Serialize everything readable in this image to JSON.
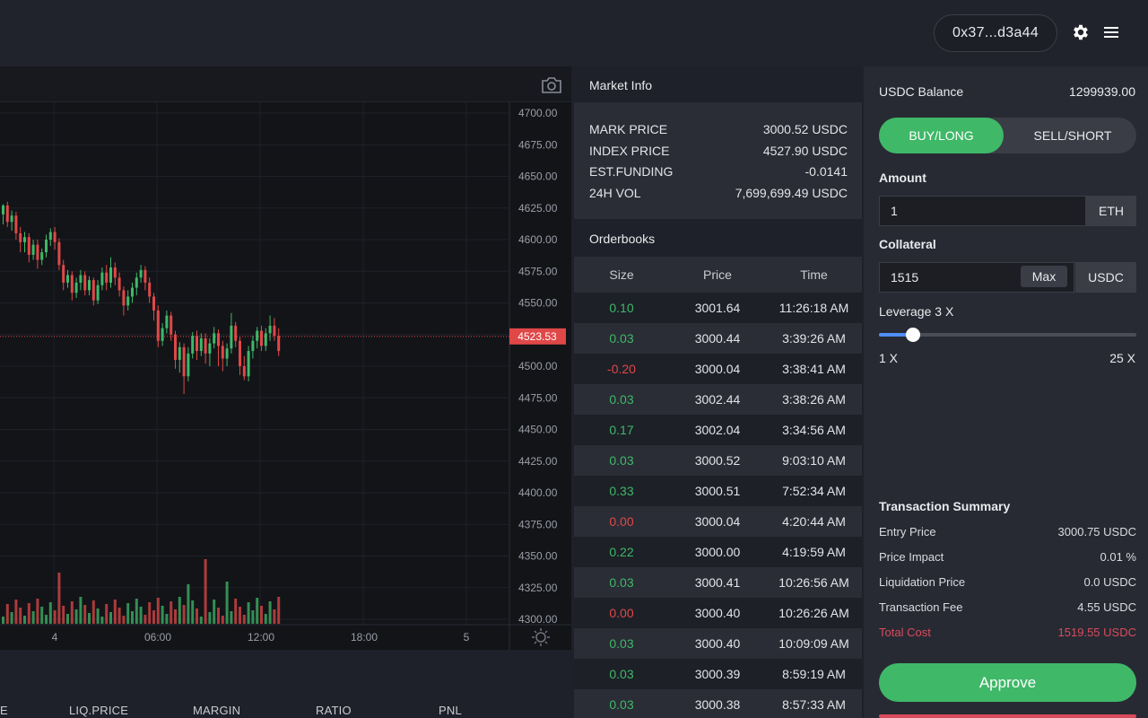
{
  "header": {
    "wallet_address": "0x37...d3a44",
    "icons": {
      "settings": "gear-icon",
      "menu": "hamburger-menu-icon"
    }
  },
  "chart": {
    "camera_icon": "camera-icon",
    "settings_icon": "sun-settings-icon",
    "current_price_label": "4523.53",
    "colors": {
      "up": "#3fb868",
      "down": "#e04848",
      "price_tag": "#e04848"
    }
  },
  "chart_data": {
    "type": "candlestick",
    "price_axis_ticks": [
      "4700.00",
      "4675.00",
      "4650.00",
      "4625.00",
      "4600.00",
      "4575.00",
      "4550.00",
      "4525.00",
      "4500.00",
      "4475.00",
      "4450.00",
      "4425.00",
      "4400.00",
      "4375.00",
      "4350.00",
      "4325.00",
      "4300.00"
    ],
    "ylim": [
      4300,
      4700
    ],
    "time_axis_ticks": [
      "4",
      "06:00",
      "12:00",
      "18:00",
      "5"
    ],
    "current_price": 4523.53,
    "candles": [
      [
        4620,
        4627,
        4612,
        4628
      ],
      [
        4627,
        4614,
        4610,
        4630
      ],
      [
        4614,
        4619,
        4607,
        4623
      ],
      [
        4619,
        4605,
        4600,
        4622
      ],
      [
        4605,
        4598,
        4590,
        4610
      ],
      [
        4598,
        4602,
        4590,
        4606
      ],
      [
        4602,
        4588,
        4582,
        4605
      ],
      [
        4588,
        4596,
        4584,
        4600
      ],
      [
        4596,
        4584,
        4577,
        4600
      ],
      [
        4584,
        4590,
        4580,
        4593
      ],
      [
        4590,
        4600,
        4586,
        4604
      ],
      [
        4600,
        4606,
        4595,
        4609
      ],
      [
        4606,
        4598,
        4592,
        4610
      ],
      [
        4598,
        4580,
        4576,
        4601
      ],
      [
        4580,
        4566,
        4560,
        4584
      ],
      [
        4566,
        4572,
        4562,
        4576
      ],
      [
        4572,
        4558,
        4552,
        4575
      ],
      [
        4558,
        4566,
        4554,
        4570
      ],
      [
        4566,
        4572,
        4560,
        4576
      ],
      [
        4572,
        4560,
        4556,
        4575
      ],
      [
        4560,
        4568,
        4556,
        4571
      ],
      [
        4568,
        4552,
        4548,
        4570
      ],
      [
        4552,
        4564,
        4549,
        4568
      ],
      [
        4564,
        4574,
        4560,
        4578
      ],
      [
        4574,
        4566,
        4560,
        4580
      ],
      [
        4566,
        4578,
        4562,
        4586
      ],
      [
        4578,
        4570,
        4564,
        4582
      ],
      [
        4570,
        4560,
        4555,
        4574
      ],
      [
        4560,
        4548,
        4540,
        4563
      ],
      [
        4548,
        4555,
        4544,
        4560
      ],
      [
        4555,
        4562,
        4550,
        4566
      ],
      [
        4562,
        4570,
        4556,
        4574
      ],
      [
        4570,
        4576,
        4566,
        4580
      ],
      [
        4576,
        4566,
        4560,
        4579
      ],
      [
        4566,
        4555,
        4550,
        4570
      ],
      [
        4555,
        4544,
        4536,
        4558
      ],
      [
        4544,
        4520,
        4515,
        4548
      ],
      [
        4520,
        4530,
        4516,
        4534
      ],
      [
        4530,
        4540,
        4526,
        4544
      ],
      [
        4540,
        4525,
        4520,
        4543
      ],
      [
        4525,
        4505,
        4498,
        4528
      ],
      [
        4505,
        4515,
        4495,
        4519
      ],
      [
        4515,
        4492,
        4478,
        4518
      ],
      [
        4492,
        4510,
        4488,
        4515
      ],
      [
        4510,
        4524,
        4506,
        4527
      ],
      [
        4524,
        4512,
        4505,
        4528
      ],
      [
        4512,
        4522,
        4508,
        4526
      ],
      [
        4522,
        4510,
        4502,
        4526
      ],
      [
        4510,
        4518,
        4500,
        4522
      ],
      [
        4518,
        4526,
        4514,
        4531
      ],
      [
        4526,
        4516,
        4500,
        4529
      ],
      [
        4516,
        4506,
        4496,
        4520
      ],
      [
        4506,
        4514,
        4500,
        4518
      ],
      [
        4514,
        4532,
        4510,
        4542
      ],
      [
        4532,
        4520,
        4515,
        4535
      ],
      [
        4520,
        4500,
        4493,
        4523
      ],
      [
        4500,
        4492,
        4489,
        4508
      ],
      [
        4492,
        4512,
        4488,
        4516
      ],
      [
        4512,
        4520,
        4506,
        4524
      ],
      [
        4520,
        4528,
        4514,
        4531
      ],
      [
        4528,
        4516,
        4512,
        4532
      ],
      [
        4516,
        4526,
        4512,
        4530
      ],
      [
        4526,
        4532,
        4520,
        4540
      ],
      [
        4532,
        4524,
        4520,
        4538
      ],
      [
        4524,
        4512,
        4508,
        4530
      ]
    ],
    "candle_fields": [
      "open",
      "close",
      "low",
      "high"
    ]
  },
  "market_info": {
    "title": "Market Info",
    "rows": [
      {
        "label": "MARK PRICE",
        "value": "3000.52 USDC"
      },
      {
        "label": "INDEX PRICE",
        "value": "4527.90 USDC"
      },
      {
        "label": "EST.FUNDING",
        "value": "-0.0141"
      },
      {
        "label": "24H VOL",
        "value": "7,699,699.49 USDC"
      }
    ]
  },
  "orderbook": {
    "title": "Orderbooks",
    "headers": {
      "size": "Size",
      "price": "Price",
      "time": "Time"
    },
    "rows": [
      {
        "size": "0.10",
        "price": "3001.64",
        "time": "11:26:18 AM",
        "dir": "up"
      },
      {
        "size": "0.03",
        "price": "3000.44",
        "time": "3:39:26 AM",
        "dir": "up"
      },
      {
        "size": "-0.20",
        "price": "3000.04",
        "time": "3:38:41 AM",
        "dir": "down"
      },
      {
        "size": "0.03",
        "price": "3002.44",
        "time": "3:38:26 AM",
        "dir": "up"
      },
      {
        "size": "0.17",
        "price": "3002.04",
        "time": "3:34:56 AM",
        "dir": "up"
      },
      {
        "size": "0.03",
        "price": "3000.52",
        "time": "9:03:10 AM",
        "dir": "up"
      },
      {
        "size": "0.33",
        "price": "3000.51",
        "time": "7:52:34 AM",
        "dir": "up"
      },
      {
        "size": "0.00",
        "price": "3000.04",
        "time": "4:20:44 AM",
        "dir": "down"
      },
      {
        "size": "0.22",
        "price": "3000.00",
        "time": "4:19:59 AM",
        "dir": "up"
      },
      {
        "size": "0.03",
        "price": "3000.41",
        "time": "10:26:56 AM",
        "dir": "up"
      },
      {
        "size": "0.00",
        "price": "3000.40",
        "time": "10:26:26 AM",
        "dir": "down"
      },
      {
        "size": "0.03",
        "price": "3000.40",
        "time": "10:09:09 AM",
        "dir": "up"
      },
      {
        "size": "0.03",
        "price": "3000.39",
        "time": "8:59:19 AM",
        "dir": "up"
      },
      {
        "size": "0.03",
        "price": "3000.38",
        "time": "8:57:33 AM",
        "dir": "up"
      }
    ]
  },
  "positions": {
    "headers": [
      "E",
      "LIQ.PRICE",
      "MARGIN",
      "RATIO",
      "PNL"
    ]
  },
  "trade": {
    "balance_label": "USDC Balance",
    "balance_value": "1299939.00",
    "buy_label": "BUY/LONG",
    "sell_label": "SELL/SHORT",
    "amount_label": "Amount",
    "amount_value": "1",
    "amount_unit": "ETH",
    "collateral_label": "Collateral",
    "collateral_value": "1515",
    "max_label": "Max",
    "collateral_unit": "USDC",
    "leverage_label": "Leverage 3 X",
    "leverage_min": "1 X",
    "leverage_max": "25 X",
    "leverage_value": 3,
    "leverage_range": [
      1,
      25
    ],
    "accent_color": "#3fb868"
  },
  "summary": {
    "title": "Transaction Summary",
    "rows": [
      {
        "label": "Entry Price",
        "value": "3000.75 USDC"
      },
      {
        "label": "Price Impact",
        "value": "0.01 %"
      },
      {
        "label": "Liquidation Price",
        "value": "0.0 USDC"
      },
      {
        "label": "Transaction Fee",
        "value": "4.55 USDC"
      },
      {
        "label": "Total Cost",
        "value": "1519.55 USDC"
      }
    ],
    "approve_label": "Approve"
  }
}
